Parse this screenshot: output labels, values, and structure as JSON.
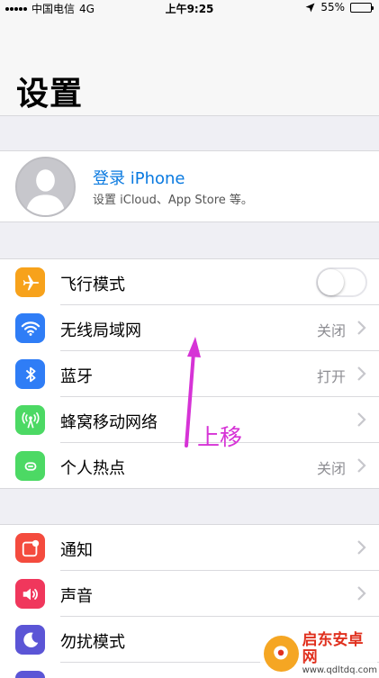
{
  "status_bar": {
    "carrier": "中国电信",
    "network": "4G",
    "time": "上午9:25",
    "battery": "55%",
    "battery_level": 0.55
  },
  "header": {
    "title": "设置"
  },
  "profile": {
    "name": "登录 iPhone",
    "subtitle": "设置 iCloud、App Store 等。"
  },
  "connectivity": [
    {
      "label": "飞行模式",
      "icon": "airplane-icon",
      "color": "#f7a21b",
      "toggle": false
    },
    {
      "label": "无线局域网",
      "icon": "wifi-icon",
      "color": "#2f7df6",
      "value": "关闭"
    },
    {
      "label": "蓝牙",
      "icon": "bluetooth-icon",
      "color": "#2f7df6",
      "value": "打开"
    },
    {
      "label": "蜂窝移动网络",
      "icon": "cellular-icon",
      "color": "#4cd964"
    },
    {
      "label": "个人热点",
      "icon": "hotspot-icon",
      "color": "#4cd964",
      "value": "关闭"
    }
  ],
  "system": [
    {
      "label": "通知",
      "icon": "notification-icon",
      "color": "#f44b3e"
    },
    {
      "label": "声音",
      "icon": "sound-icon",
      "color": "#f0375c"
    },
    {
      "label": "勿扰模式",
      "icon": "moon-icon",
      "color": "#5b55d6"
    }
  ],
  "annotation": {
    "text": "上移",
    "color": "#d633d6"
  },
  "watermark": {
    "name": "启东安卓网",
    "url": "www.qdltdq.com"
  }
}
